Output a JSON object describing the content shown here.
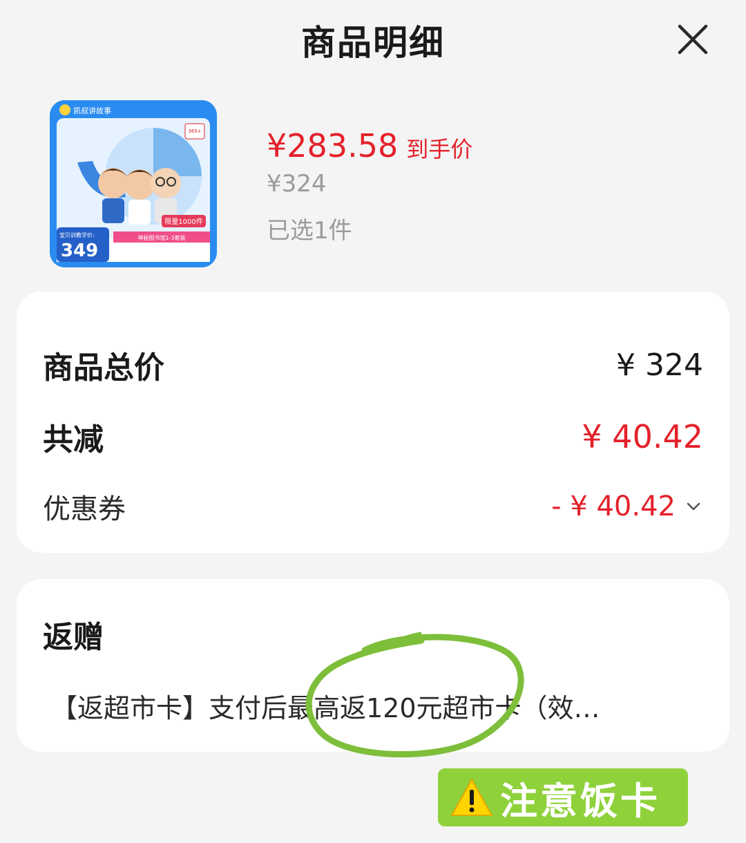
{
  "header": {
    "title": "商品明细",
    "close_icon": "close-icon"
  },
  "product": {
    "thumb": {
      "brand": "凯叔讲故事",
      "badge_top": "365+",
      "price_caption": "宝贝训教学价:",
      "price": "349",
      "limit_label": "限量1000件",
      "ribbon": "神秘图书馆1-3套装"
    },
    "final_price": "¥283.58",
    "final_price_label": "到手价",
    "original_price": "¥324",
    "selected": "已选1件"
  },
  "summary": {
    "total_label": "商品总价",
    "total_value": "¥ 324",
    "discount_label": "共减",
    "discount_value": "¥ 40.42",
    "coupon_label": "优惠券",
    "coupon_value": "- ¥ 40.42",
    "coupon_icon": "chevron-down-icon"
  },
  "rebate": {
    "title": "返赠",
    "description": "【返超市卡】支付后最高返120元超市卡（效…"
  },
  "annotation": {
    "sticker_text": "注意饭卡",
    "sticker_icon": "warning-icon",
    "colors": {
      "circle": "#7dbe3a",
      "sticker": "#8fd13b"
    }
  },
  "colors": {
    "accent_red": "#e4202a",
    "muted_gray": "#9b9b9b",
    "background": "#f4f4f4"
  }
}
